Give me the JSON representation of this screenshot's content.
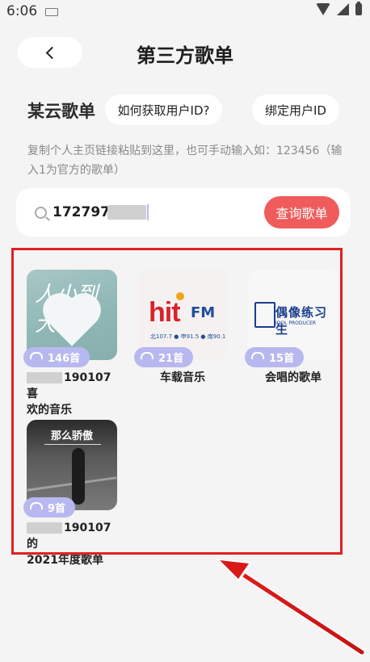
{
  "status": {
    "time": "6:06"
  },
  "header": {
    "title": "第三方歌单"
  },
  "source": {
    "title": "某云歌单",
    "help_label": "如何获取用户ID?",
    "bind_label": "绑定用户ID",
    "hint": "复制个人主页链接粘贴到这里，也可手动输入如：123456（输入1为官方的歌单）"
  },
  "search": {
    "value": "172797",
    "query_label": "查询歌单"
  },
  "playlists": [
    {
      "count": "146首",
      "title_line1": "190107喜",
      "title_line2": "欢的音乐",
      "cover_text": "人小到大"
    },
    {
      "count": "21首",
      "title": "车载音乐",
      "cover_hit": "hit",
      "cover_fm": "FM",
      "cover_freq": "北107.7 ● 申91.5 ● 南90.1"
    },
    {
      "count": "15首",
      "title": "会唱的歌单",
      "cover_name": "偶像练习生",
      "cover_sub": "IDOL PRODUCER"
    },
    {
      "count": "9首",
      "title_line1": "190107的",
      "title_line2": "2021年度歌单",
      "cover_label": "那么骄傲"
    }
  ],
  "colors": {
    "accent": "#f05b5b",
    "badge": "#b8b8f0",
    "highlight": "#e02020"
  }
}
